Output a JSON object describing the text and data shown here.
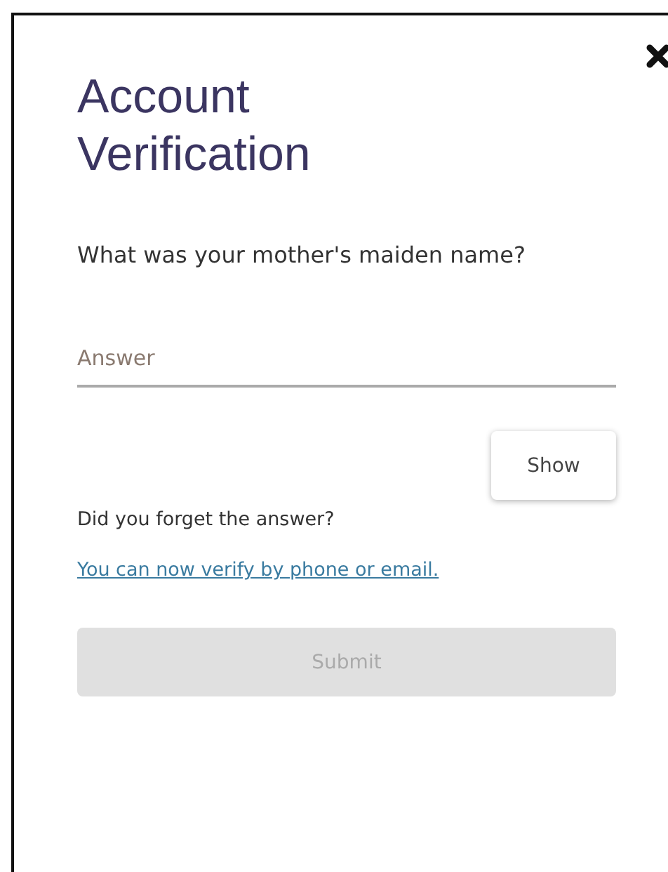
{
  "dialog": {
    "title": "Account Verification",
    "question": "What was your mother's maiden name?",
    "answer": {
      "placeholder": "Answer"
    },
    "show_button": "Show",
    "forgot_text": "Did you forget the answer?",
    "alt_link": "You can now verify by phone or email.",
    "submit": {
      "label": "Submit",
      "disabled": true
    }
  }
}
